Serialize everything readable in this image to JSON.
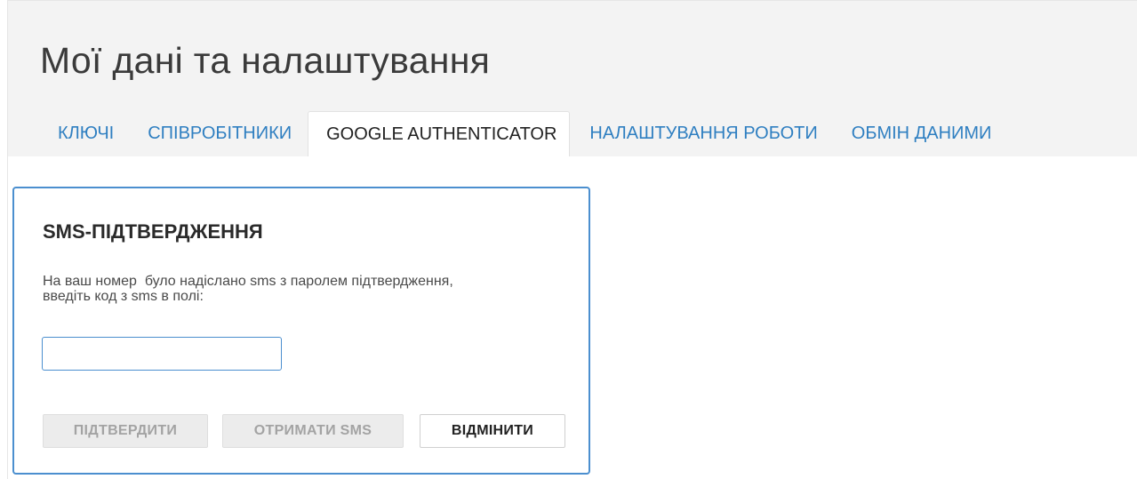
{
  "page": {
    "title": "Мої дані та налаштування"
  },
  "tabs": [
    {
      "label": "КЛЮЧІ",
      "active": false
    },
    {
      "label": "СПІВРОБІТНИКИ",
      "active": false
    },
    {
      "label": "GOOGLE AUTHENTICATOR",
      "active": true
    },
    {
      "label": "НАЛАШТУВАННЯ РОБОТИ",
      "active": false
    },
    {
      "label": "ОБМІН ДАНИМИ",
      "active": false
    }
  ],
  "sms_panel": {
    "title": "SMS-ПІДТВЕРДЖЕННЯ",
    "message_line1": "На ваш номер  було надіслано sms з паролем підтвердження,",
    "message_line2": "введіть код з sms в полі:",
    "code_value": "",
    "buttons": {
      "confirm": {
        "label": "ПІДТВЕРДИТИ",
        "enabled": false
      },
      "get_sms": {
        "label": "ОТРИМАТИ SMS",
        "enabled": false
      },
      "cancel": {
        "label": "ВІДМІНИТИ",
        "enabled": true
      }
    }
  },
  "colors": {
    "accent": "#4b8fcf",
    "tab_link": "#2f7fc1",
    "header_bg": "#f3f3f3"
  }
}
